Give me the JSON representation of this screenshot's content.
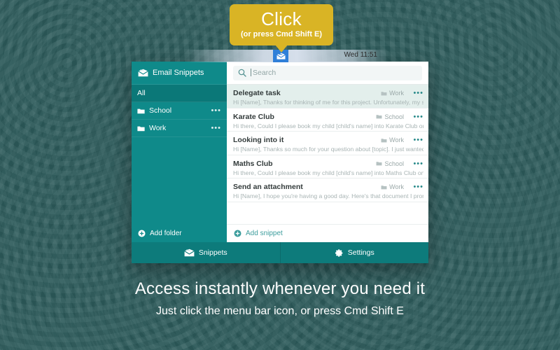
{
  "callout": {
    "title": "Click",
    "subtitle": "(or press Cmd Shift E)",
    "bg_color": "#d9b425"
  },
  "menubar": {
    "clock": "Wed 11:51",
    "app_icon": "email-snippets-icon",
    "highlight_color": "#2f7fd8"
  },
  "window": {
    "sidebar": {
      "app_icon": "email-snippets-icon",
      "app_title": "Email Snippets",
      "folders": [
        {
          "label": "All",
          "selected": true,
          "has_menu": false,
          "icon": ""
        },
        {
          "label": "School",
          "selected": false,
          "has_menu": true,
          "icon": "folder-icon"
        },
        {
          "label": "Work",
          "selected": false,
          "has_menu": true,
          "icon": "folder-icon"
        }
      ],
      "add_folder_label": "Add folder",
      "add_folder_icon": "plus-circle-icon",
      "bg_color": "#0f8a8a"
    },
    "search": {
      "placeholder": "Search",
      "icon": "search-icon",
      "value": ""
    },
    "snippets": [
      {
        "title": "Delegate task",
        "tag": "Work",
        "preview": "Hi [Name], Thanks for thinking of me for this project. Unfortunately, my schedule is ja...",
        "selected": true
      },
      {
        "title": "Karate Club",
        "tag": "School",
        "preview": "Hi there, Could I please book my child [child's name] into Karate Club on [date]? Thank...",
        "selected": false
      },
      {
        "title": "Looking into it",
        "tag": "Work",
        "preview": "Hi [Name], Thanks so much for your question about [topic]. I just wanted to let you kn...",
        "selected": false
      },
      {
        "title": "Maths Club",
        "tag": "School",
        "preview": "Hi there, Could I please book my child [child's name] into Maths Club on [date]? Thanks...",
        "selected": false
      },
      {
        "title": "Send an attachment",
        "tag": "Work",
        "preview": "Hi [Name], I hope you're having a good day. Here's that document I promised you. Plea...",
        "selected": false
      }
    ],
    "add_snippet_label": "Add snippet",
    "add_snippet_icon": "plus-circle-icon",
    "tabs": [
      {
        "label": "Snippets",
        "icon": "envelope-icon",
        "active": true
      },
      {
        "label": "Settings",
        "icon": "gear-icon",
        "active": false
      }
    ],
    "row_menu_icon": "ellipsis-icon"
  },
  "caption": {
    "headline": "Access instantly whenever you need it",
    "subline": "Just click the menu bar icon, or press Cmd Shift E"
  },
  "background": {
    "color": "#2d5c5c"
  }
}
